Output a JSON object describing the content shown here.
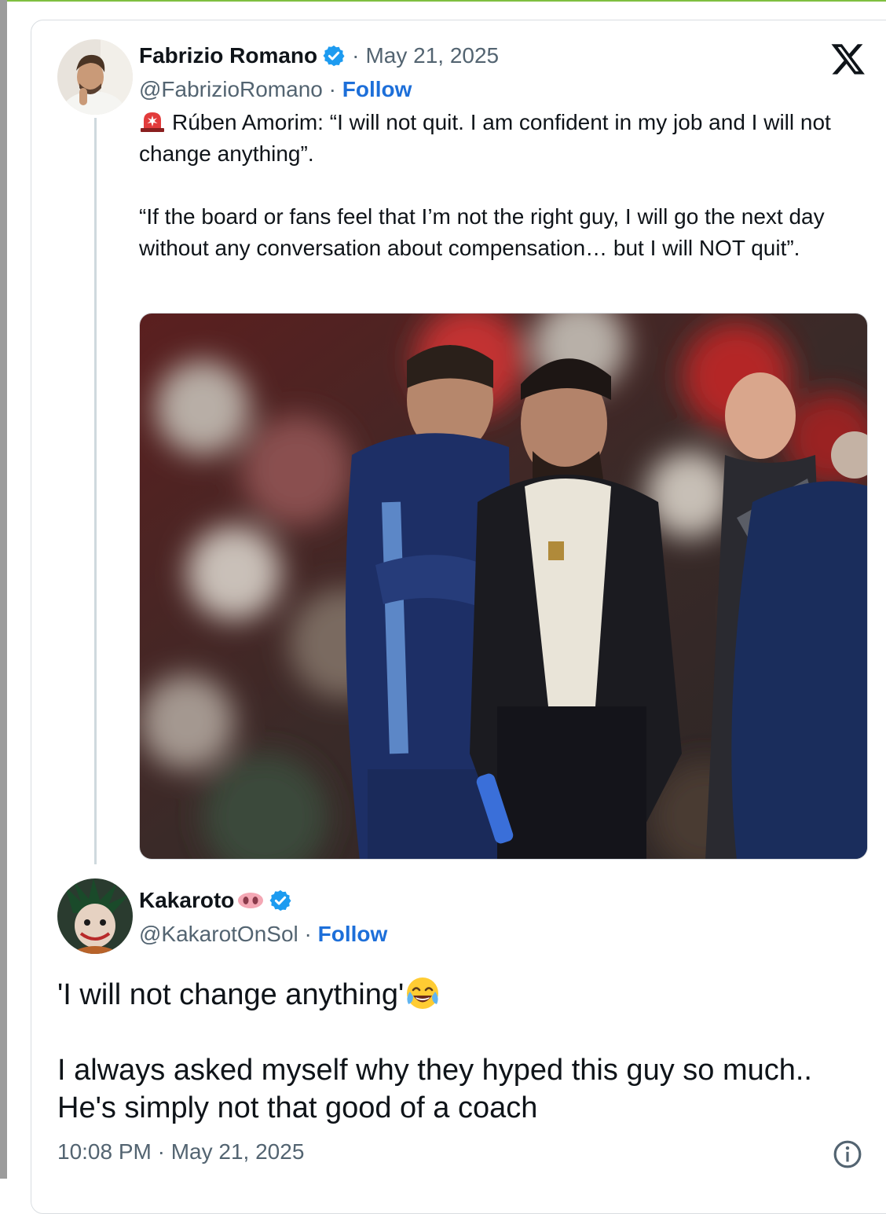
{
  "quoted_tweet": {
    "author_name": "Fabrizio Romano",
    "separator": "·",
    "date": "May 21, 2025",
    "handle": "@FabrizioRomano",
    "follow_label": "Follow",
    "text_line1": "Rúben Amorim: “I will not quit. I am confident in my job and I will not change anything”.",
    "text_line2": "“If the board or fans feel that I’m not the right guy, I will go the next day without any conversation about compensation… but I will NOT quit”.",
    "icons": {
      "verified": "verified-badge-icon",
      "siren": "police-light-icon",
      "logo": "x-logo-icon"
    }
  },
  "reply_tweet": {
    "author_name": "Kakaroto",
    "handle": "@KakarotOnSol",
    "follow_label": "Follow",
    "text_line1": "'I will not change anything'",
    "text_line2": "I always asked myself why they hyped this guy so much.. He's simply not that good of a coach",
    "timestamp": "10:08 PM · May 21, 2025",
    "icons": {
      "emoji": "face-with-tears-of-joy-icon",
      "pig": "pig-nose-icon",
      "info": "info-icon"
    }
  },
  "colors": {
    "link": "#1d6fd9",
    "verified": "#1d9bf0",
    "muted": "#536471"
  }
}
